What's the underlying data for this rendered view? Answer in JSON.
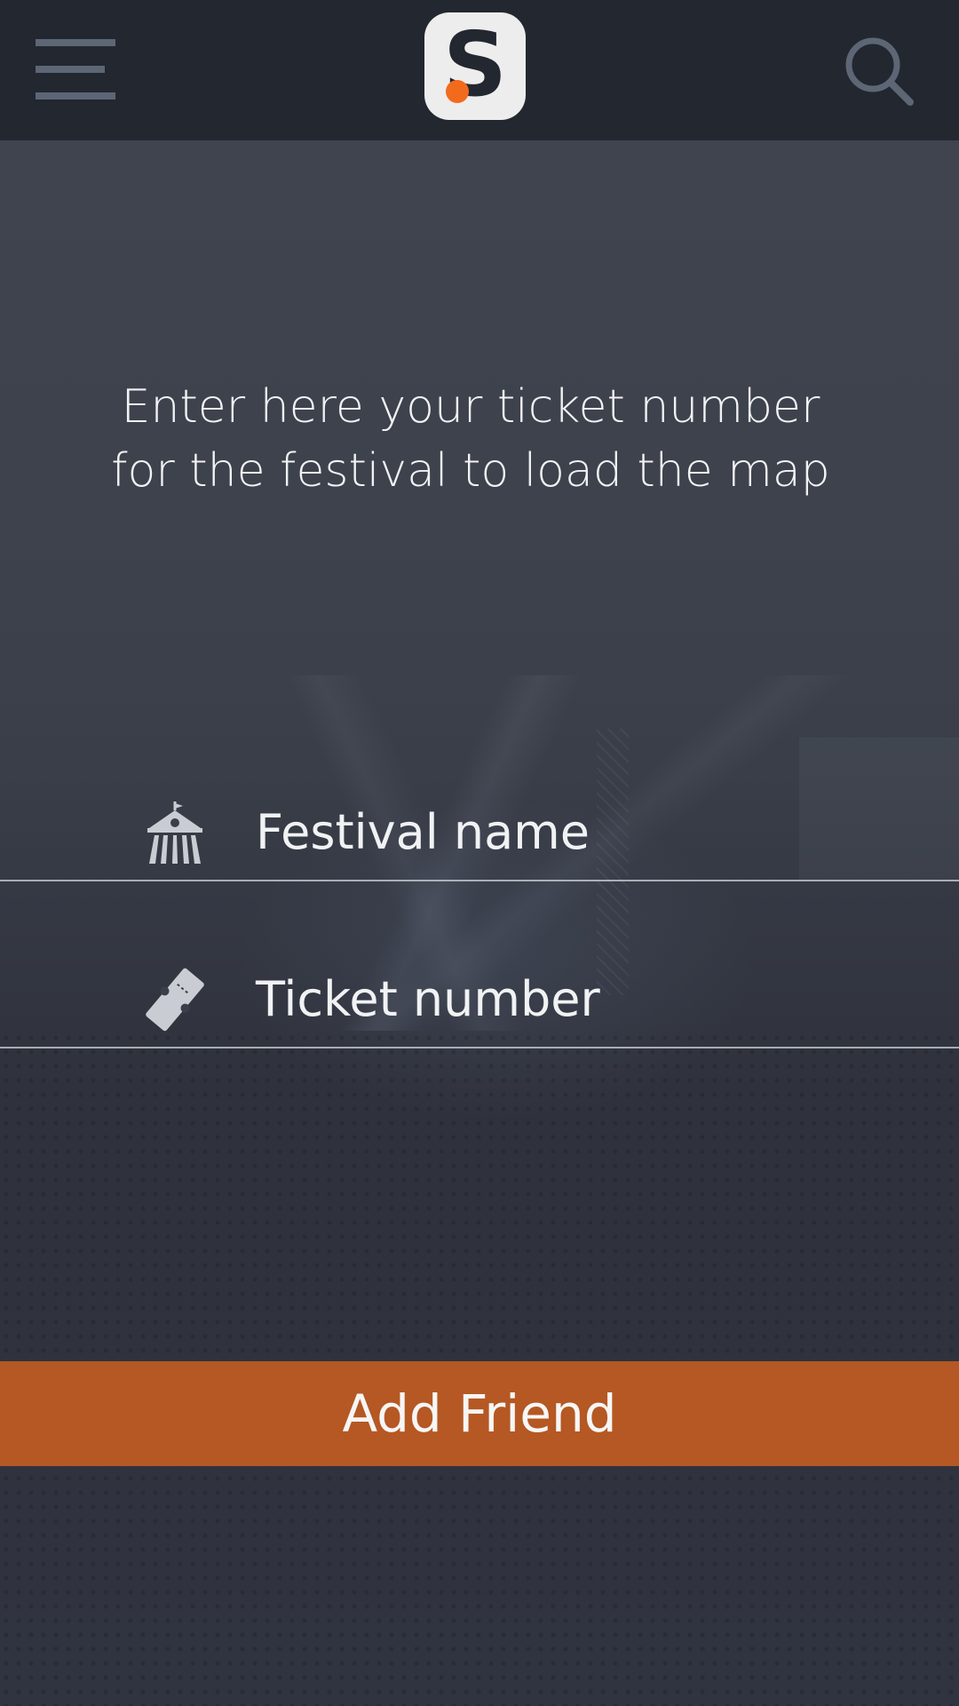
{
  "header": {
    "menu_icon": "hamburger-menu-icon",
    "logo": {
      "letter": "S",
      "accent_color": "#f26b1d"
    },
    "search_icon": "search-icon"
  },
  "main": {
    "headline_line1": "Enter here your ticket number",
    "headline_line2": "for the festival to load the map",
    "fields": [
      {
        "label": "Festival name",
        "icon": "festival-tent-icon"
      },
      {
        "label": "Ticket number",
        "icon": "ticket-icon"
      }
    ],
    "button_label": "Add Friend"
  },
  "colors": {
    "header_bg": "#222730",
    "button_bg": "#b55823",
    "text": "#f1f2f4"
  }
}
